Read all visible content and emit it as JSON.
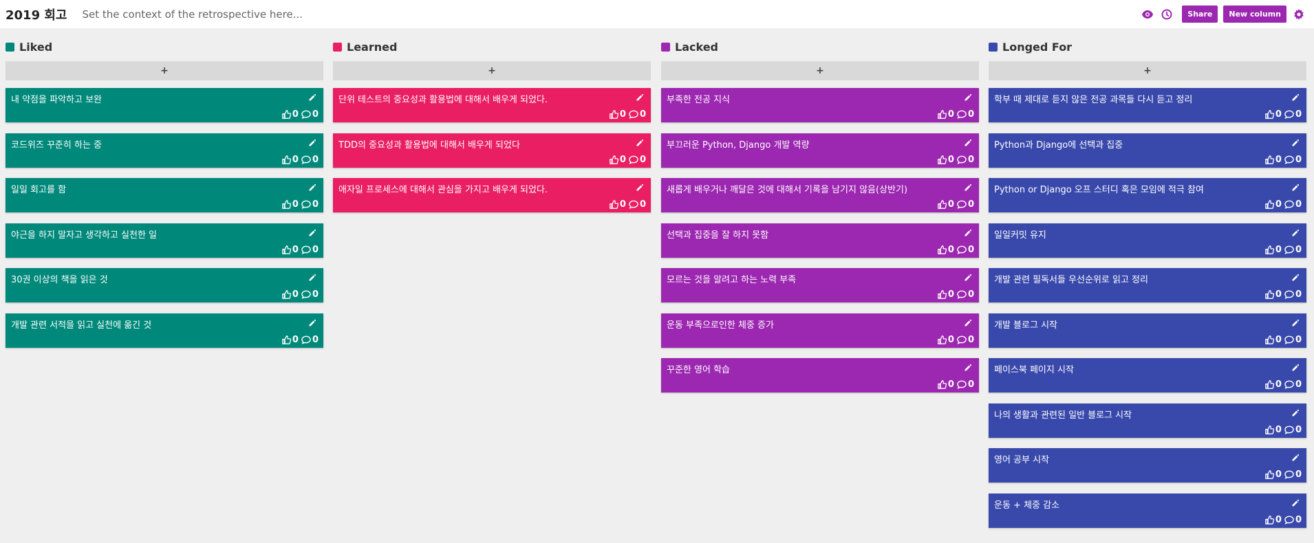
{
  "header": {
    "title": "2019 회고",
    "context_placeholder": "Set the context of the retrospective here...",
    "share_label": "Share",
    "new_column_label": "New column",
    "icons": [
      "eye-icon",
      "clock-icon",
      "gear-icon"
    ],
    "accent_color": "#9c27b0"
  },
  "add_label": "+",
  "columns": [
    {
      "title": "Liked",
      "color": "#00897b",
      "cards": [
        {
          "text": "내 약점을 파악하고 보완",
          "votes": "0",
          "comments": "0"
        },
        {
          "text": "코드위즈 꾸준히 하는 중",
          "votes": "0",
          "comments": "0"
        },
        {
          "text": "일일 회고를 함",
          "votes": "0",
          "comments": "0"
        },
        {
          "text": "야근을 하지 말자고 생각하고 실천한 일",
          "votes": "0",
          "comments": "0"
        },
        {
          "text": "30권 이상의 책을 읽은 것",
          "votes": "0",
          "comments": "0"
        },
        {
          "text": "개발 관련 서적을 읽고 실천에 옮긴 것",
          "votes": "0",
          "comments": "0"
        }
      ]
    },
    {
      "title": "Learned",
      "color": "#e91e63",
      "cards": [
        {
          "text": "단위 테스트의 중요성과 활용법에 대해서 배우게 되었다.",
          "votes": "0",
          "comments": "0"
        },
        {
          "text": "TDD의 중요성과 활용법에 대해서 배우게 되었다",
          "votes": "0",
          "comments": "0"
        },
        {
          "text": "애자일 프로세스에 대해서 관심을 가지고 배우게 되었다.",
          "votes": "0",
          "comments": "0"
        }
      ]
    },
    {
      "title": "Lacked",
      "color": "#9c27b0",
      "cards": [
        {
          "text": "부족한 전공 지식",
          "votes": "0",
          "comments": "0"
        },
        {
          "text": "부끄러운 Python, Django 개발 역량",
          "votes": "0",
          "comments": "0"
        },
        {
          "text": "새롭게 배우거나 깨달은 것에 대해서 기록을 남기지 않음(상반기)",
          "votes": "0",
          "comments": "0"
        },
        {
          "text": "선택과 집중을 잘 하지 못함",
          "votes": "0",
          "comments": "0"
        },
        {
          "text": "모르는 것을 알려고 하는 노력 부족",
          "votes": "0",
          "comments": "0"
        },
        {
          "text": "운동 부족으로인한 체중 증가",
          "votes": "0",
          "comments": "0"
        },
        {
          "text": "꾸준한 영어 학습",
          "votes": "0",
          "comments": "0"
        }
      ]
    },
    {
      "title": "Longed For",
      "color": "#3949ab",
      "cards": [
        {
          "text": "학부 때 제대로 듣지 않은 전공 과목들 다시 듣고 정리",
          "votes": "0",
          "comments": "0"
        },
        {
          "text": "Python과 Django에 선택과 집중",
          "votes": "0",
          "comments": "0"
        },
        {
          "text": "Python or Django 오프 스터디 혹은 모임에 적극 참여",
          "votes": "0",
          "comments": "0"
        },
        {
          "text": "일일커밋 유지",
          "votes": "0",
          "comments": "0"
        },
        {
          "text": "개발 관련 필독서들 우선순위로 읽고 정리",
          "votes": "0",
          "comments": "0"
        },
        {
          "text": "개발 블로그 시작",
          "votes": "0",
          "comments": "0"
        },
        {
          "text": "페이스북 페이지 시작",
          "votes": "0",
          "comments": "0"
        },
        {
          "text": "나의 생활과 관련된 일반 블로그 시작",
          "votes": "0",
          "comments": "0"
        },
        {
          "text": "영어 공부 시작",
          "votes": "0",
          "comments": "0"
        },
        {
          "text": "운동 + 체중 감소",
          "votes": "0",
          "comments": "0"
        }
      ]
    }
  ]
}
